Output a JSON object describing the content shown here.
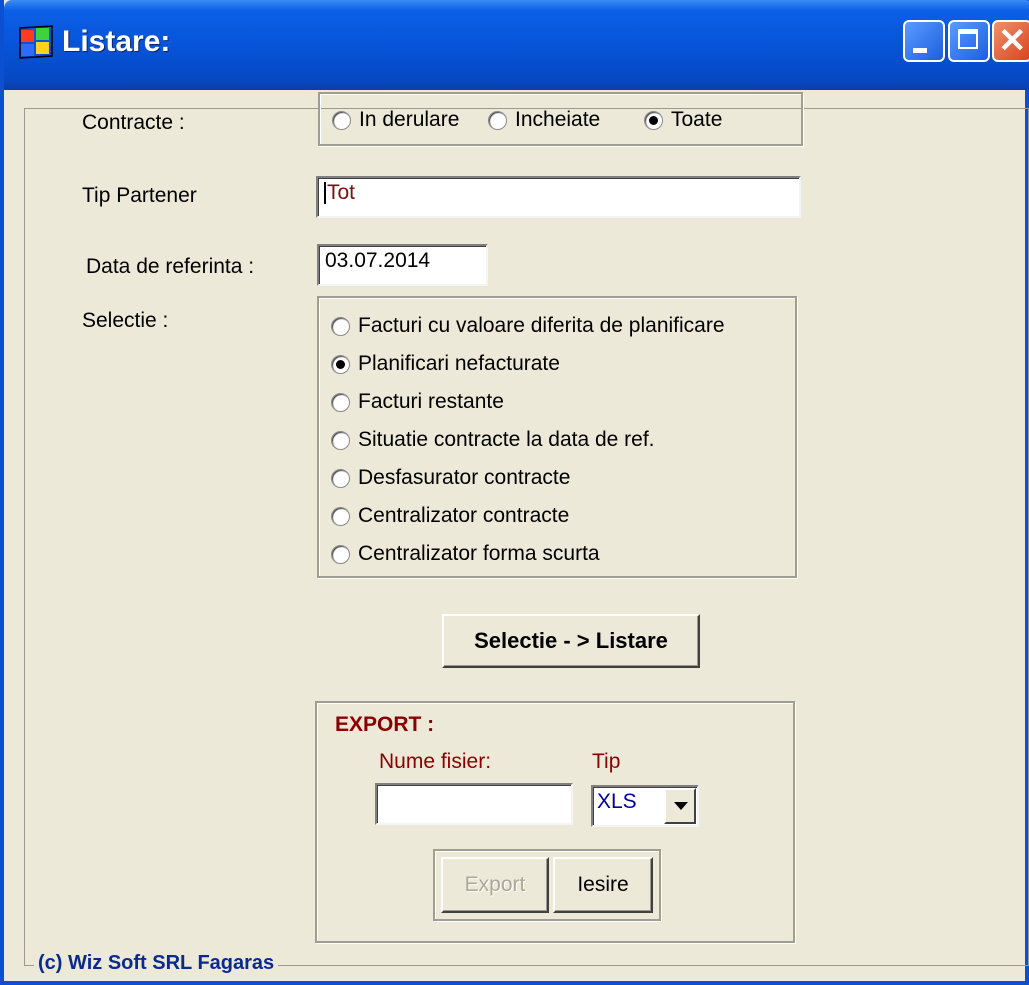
{
  "window": {
    "title": "Listare:"
  },
  "contracte": {
    "label": "Contracte :",
    "options": [
      {
        "label": "In derulare",
        "selected": false
      },
      {
        "label": "Incheiate",
        "selected": false
      },
      {
        "label": "Toate",
        "selected": true
      }
    ]
  },
  "tip_partener": {
    "label": "Tip Partener",
    "value": "Tot"
  },
  "data_referinta": {
    "label": "Data de referinta :",
    "value": "03.07.2014"
  },
  "selectie": {
    "label": "Selectie :",
    "options": [
      {
        "label": "Facturi cu valoare diferita de planificare",
        "selected": false
      },
      {
        "label": "Planificari nefacturate",
        "selected": true
      },
      {
        "label": "Facturi restante",
        "selected": false
      },
      {
        "label": "Situatie contracte la data de ref.",
        "selected": false
      },
      {
        "label": "Desfasurator contracte",
        "selected": false
      },
      {
        "label": "Centralizator contracte",
        "selected": false
      },
      {
        "label": "Centralizator forma scurta",
        "selected": false
      }
    ]
  },
  "listare_button": "Selectie -  > Listare",
  "export": {
    "title": "EXPORT :",
    "filename_label": "Nume fisier:",
    "filename_value": "",
    "type_label": "Tip",
    "type_value": "XLS",
    "export_button": "Export",
    "exit_button": "Iesire"
  },
  "footer": "(c) Wiz Soft SRL Fagaras",
  "colors": {
    "title_bar": "#0754d9",
    "dialog_bg": "#ece9d8",
    "dark_red": "#8b0000",
    "footer_blue": "#0a2b8c",
    "input_text_red": "#7a1010",
    "select_text_blue": "#0000a0"
  }
}
